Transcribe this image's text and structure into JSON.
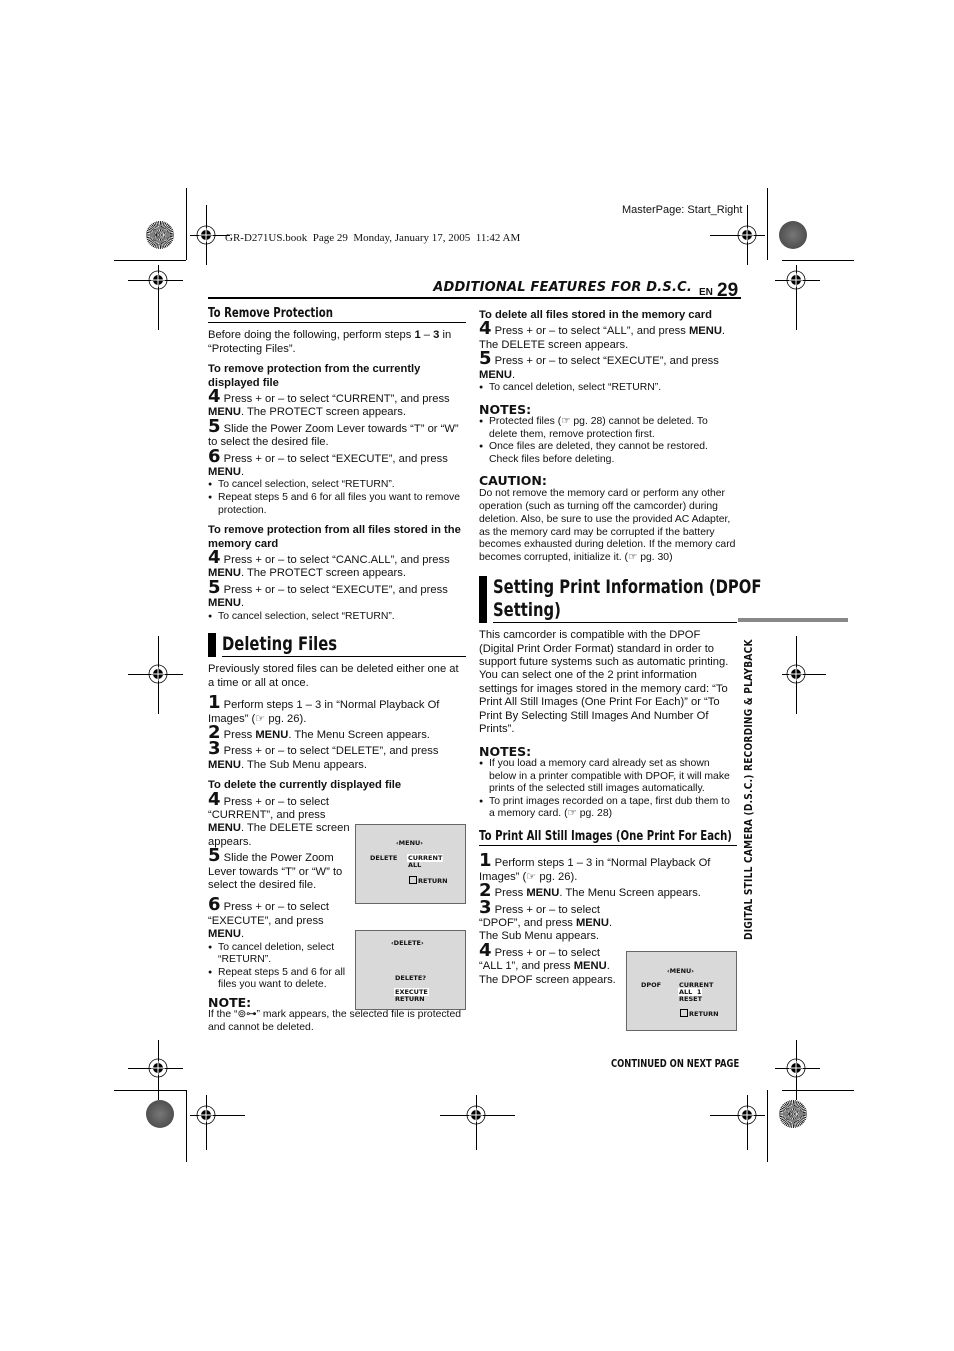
{
  "print_meta": {
    "master_page": "MasterPage: Start_Right",
    "book_info": "GR-D271US.book  Page 29  Monday, January 17, 2005  11:42 AM"
  },
  "header": {
    "section_title": "ADDITIONAL FEATURES FOR D.S.C.",
    "lang": "EN",
    "page_number": "29"
  },
  "side_tab": "DIGITAL STILL CAMERA (D.S.C.) RECORDING & PLAYBACK",
  "left_column": {
    "remove_protection": {
      "title": "To Remove Protection",
      "intro_pre": "Before doing the following, perform steps ",
      "intro_b1": "1",
      "intro_mid": " – ",
      "intro_b2": "3",
      "intro_post": " in “Protecting Files”.",
      "current": {
        "heading": "To remove protection from the currently displayed file",
        "steps": [
          {
            "num": "4",
            "pre": "Press + or – to select “CURRENT”, and press ",
            "bold": "MENU",
            "post": ". The PROTECT screen appears."
          },
          {
            "num": "5",
            "pre": "Slide the Power Zoom Lever towards “T” or “W” to select the desired file.",
            "bold": "",
            "post": ""
          },
          {
            "num": "6",
            "pre": "Press + or – to select “EXECUTE”, and press ",
            "bold": "MENU",
            "post": "."
          }
        ],
        "bullets": [
          "To cancel selection, select “RETURN”.",
          "Repeat steps 5 and 6 for all files you want to remove protection."
        ]
      },
      "all": {
        "heading": "To remove protection from all files stored in the memory card",
        "steps": [
          {
            "num": "4",
            "pre": "Press + or – to select “CANC.ALL”, and press ",
            "bold": "MENU",
            "post": ". The PROTECT screen appears."
          },
          {
            "num": "5",
            "pre": "Press + or – to select “EXECUTE”, and press ",
            "bold": "MENU",
            "post": "."
          }
        ],
        "bullets": [
          "To cancel selection, select “RETURN”."
        ]
      }
    },
    "deleting_files": {
      "title": "Deleting Files",
      "intro": "Previously stored files can be deleted either one at a time or all at once.",
      "steps": [
        {
          "num": "1",
          "text": "Perform steps 1 – 3 in “Normal Playback Of Images” (☞ pg. 26)."
        },
        {
          "num": "2",
          "pre": "Press ",
          "bold": "MENU",
          "post": ". The Menu Screen appears."
        },
        {
          "num": "3",
          "pre": "Press + or – to select “DELETE”, and press ",
          "bold": "MENU",
          "post": ". The Sub Menu appears."
        }
      ],
      "current_heading": "To delete the currently displayed file",
      "current_steps": [
        {
          "num": "4",
          "pre": "Press + or – to select “CURRENT”, and press ",
          "bold": "MENU",
          "post": ". The DELETE screen appears."
        },
        {
          "num": "5",
          "pre": "Slide the Power Zoom Lever towards “T” or “W” to select the desired file.",
          "bold": "",
          "post": ""
        },
        {
          "num": "6",
          "pre": "Press + or – to select “EXECUTE”, and press ",
          "bold": "MENU",
          "post": "."
        }
      ],
      "current_bullets": [
        "To cancel deletion, select “RETURN”.",
        "Repeat steps 5 and 6 for all files you want to delete."
      ],
      "note_heading": "NOTE:",
      "note": "If the “⊚⊶” mark appears, the selected file is protected and cannot be deleted."
    },
    "screen_menu": {
      "title": "‹MENU›",
      "label": "DELETE",
      "options": [
        "CURRENT",
        "ALL"
      ],
      "return": "RETURN"
    },
    "screen_delete": {
      "title": "‹DELETE›",
      "question": "DELETE?",
      "options": [
        "EXECUTE",
        "RETURN"
      ]
    }
  },
  "right_column": {
    "delete_all": {
      "heading": "To delete all files stored in the memory card",
      "steps": [
        {
          "num": "4",
          "pre": "Press + or – to select “ALL”, and press ",
          "bold": "MENU",
          "post": ". The DELETE screen appears."
        },
        {
          "num": "5",
          "pre": "Press + or – to select “EXECUTE”, and press ",
          "bold": "MENU",
          "post": "."
        }
      ],
      "bullets": [
        "To cancel deletion, select “RETURN”."
      ]
    },
    "notes": {
      "heading": "NOTES:",
      "items": [
        "Protected files (☞ pg. 28) cannot be deleted. To delete them, remove protection first.",
        "Once files are deleted, they cannot be restored. Check files before deleting."
      ]
    },
    "caution": {
      "heading": "CAUTION:",
      "text": "Do not remove the memory card or perform any other operation (such as turning off the camcorder) during deletion. Also, be sure to use the provided AC Adapter, as the memory card may be corrupted if the battery becomes exhausted during deletion. If the memory card becomes corrupted, initialize it. (☞ pg. 30)"
    },
    "dpof": {
      "title_line1": "Setting Print Information (DPOF",
      "title_line2": "Setting)",
      "intro": "This camcorder is compatible with the DPOF (Digital Print Order Format) standard in order to support future systems such as automatic printing. You can select one of the 2 print information settings for images stored in the memory card: “To Print All Still Images (One Print For Each)” or “To Print By Selecting Still Images And Number Of Prints”.",
      "notes_heading": "NOTES:",
      "notes": [
        "If you load a memory card already set as shown below in a printer compatible with DPOF, it will make prints of the selected still images automatically.",
        "To print images recorded on a tape, first dub them to a memory card. (☞ pg. 28)"
      ],
      "subheading": "To Print All Still Images (One Print For Each)",
      "steps": [
        {
          "num": "1",
          "text": "Perform steps 1 – 3 in “Normal Playback Of Images” (☞ pg. 26)."
        },
        {
          "num": "2",
          "pre": "Press ",
          "bold": "MENU",
          "post": ". The Menu Screen appears."
        },
        {
          "num": "3",
          "pre": "Press + or – to select “DPOF”, and press ",
          "bold": "MENU",
          "post": ". The Sub Menu appears."
        },
        {
          "num": "4",
          "pre": "Press + or – to select “ALL 1”, and press ",
          "bold": "MENU",
          "post": ". The DPOF screen appears."
        }
      ]
    },
    "screen_dpof": {
      "title": "‹MENU›",
      "label": "DPOF",
      "options": [
        "CURRENT",
        "ALL  1",
        "RESET"
      ],
      "return": "RETURN"
    },
    "continued": "CONTINUED ON NEXT PAGE"
  }
}
